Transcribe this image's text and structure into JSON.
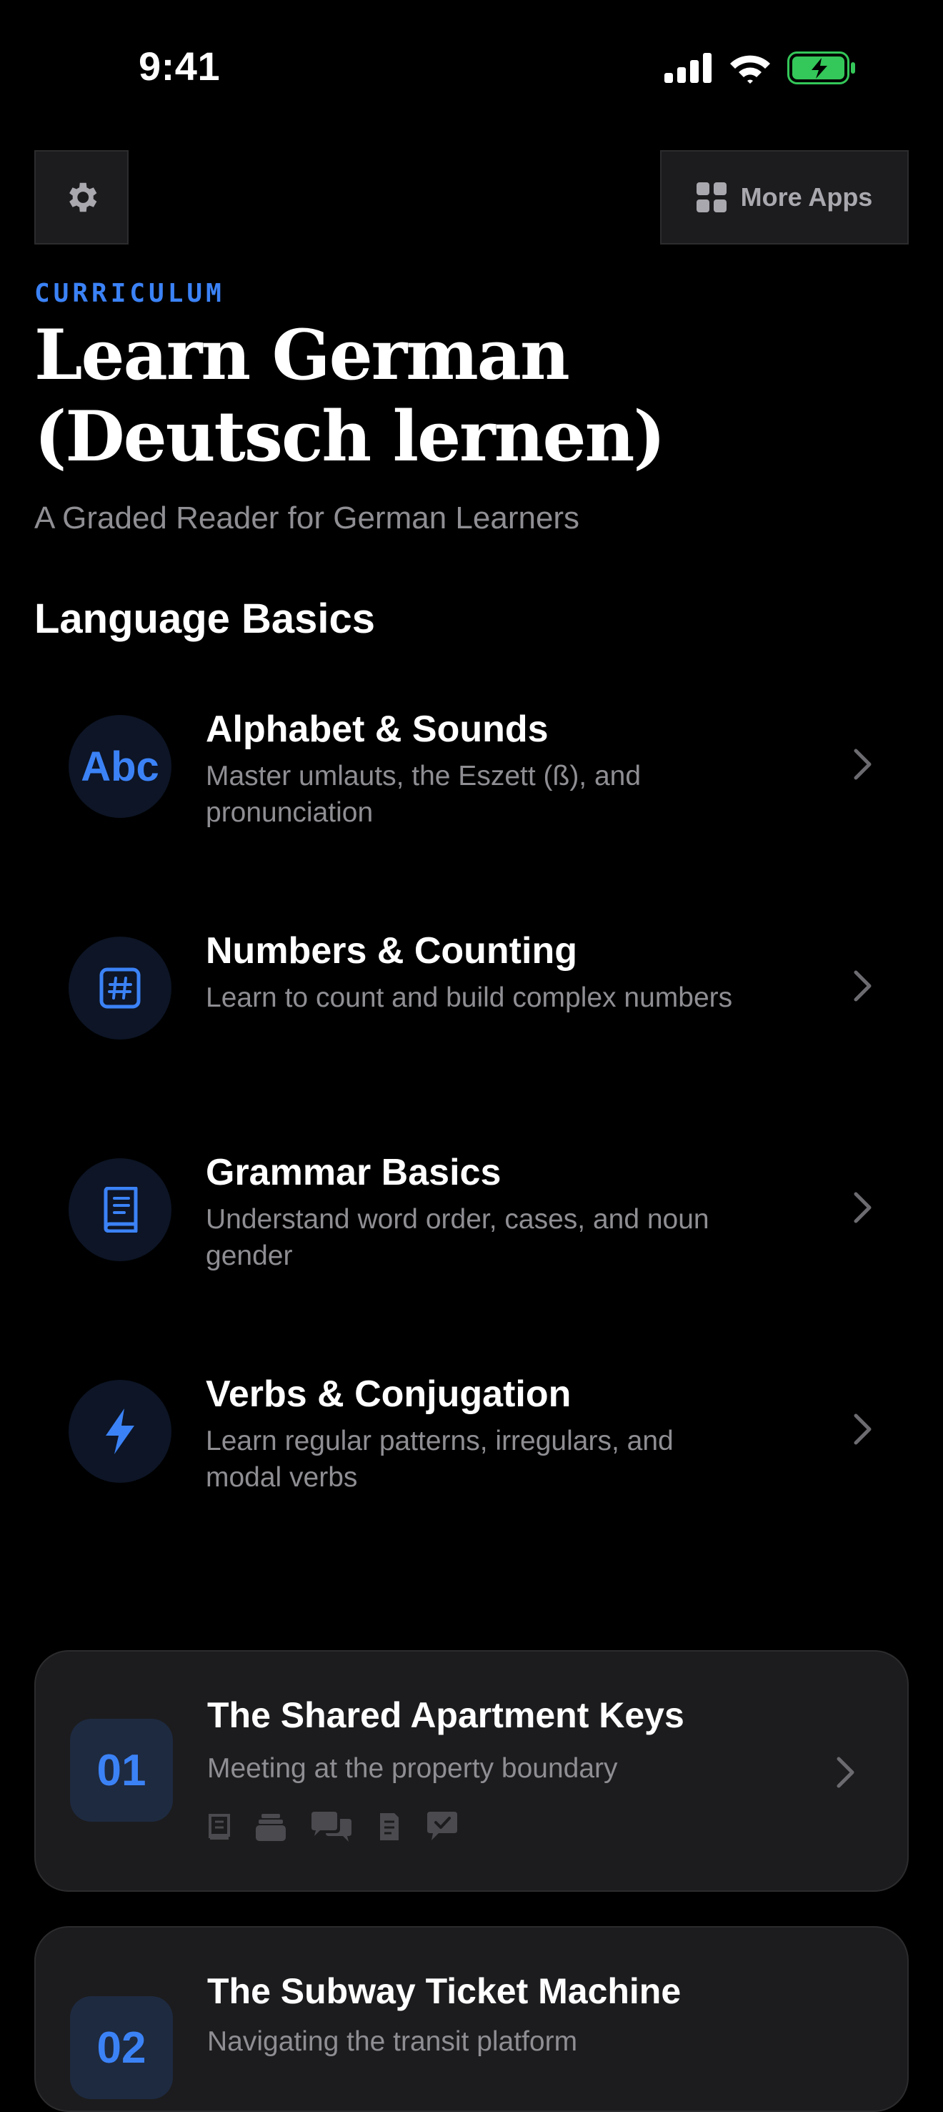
{
  "status_bar": {
    "time": "9:41"
  },
  "header": {
    "more_apps_label": "More Apps",
    "eyebrow": "CURRICULUM",
    "title": "Learn German (Deutsch lernen)",
    "subtitle": "A Graded Reader for German Learners"
  },
  "section_title": "Language Basics",
  "topics": [
    {
      "icon": "abc-icon",
      "icon_text": "Abc",
      "title": "Alphabet & Sounds",
      "desc": "Master umlauts, the Eszett (ß), and pronunciation"
    },
    {
      "icon": "hashtag-icon",
      "title": "Numbers & Counting",
      "desc": "Learn to count and build complex numbers"
    },
    {
      "icon": "book-icon",
      "title": "Grammar Basics",
      "desc": "Understand word order, cases, and noun gender"
    },
    {
      "icon": "bolt-icon",
      "title": "Verbs & Conjugation",
      "desc": "Learn regular patterns, irregulars, and modal verbs"
    }
  ],
  "lessons": [
    {
      "number": "01",
      "title": "The Shared Apartment Keys",
      "subtitle": "Meeting at the property boundary",
      "feature_icons": [
        "book-icon",
        "cards-icon",
        "chat-bubbles-icon",
        "document-icon",
        "quiz-check-icon"
      ]
    },
    {
      "number": "02",
      "title": "The Subway Ticket Machine",
      "subtitle": "Navigating the transit platform"
    }
  ],
  "colors": {
    "accent": "#3b82f6",
    "background": "#000000",
    "card": "#1c1c1e",
    "battery": "#34c759"
  }
}
